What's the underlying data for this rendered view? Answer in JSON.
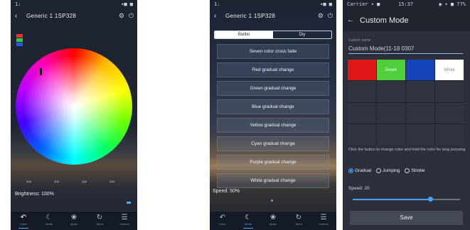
{
  "colors": {
    "accent": "#5aa7e8",
    "cell_red": "#e01818",
    "cell_green": "#4fcf3a",
    "cell_blue": "#1545b8",
    "cell_white": "#ffffff",
    "swatch_red": "#ff2b2b",
    "swatch_green": "#2bd13a",
    "swatch_blue": "#2b56ff"
  },
  "phone1": {
    "status_left": "1:",
    "status_right": "▾■ ■",
    "back_icon": "‹",
    "title": "Generic 1 1SP328",
    "header_icon1": "⚙",
    "header_icon2": "⏻",
    "presets": [
      ">>",
      ">>",
      ">>",
      ">>"
    ],
    "brightness_label": "Brightness: 100%",
    "tabs": [
      {
        "icon": "↶",
        "label": "Color"
      },
      {
        "icon": "☾",
        "label": "Mode"
      },
      {
        "icon": "❀",
        "label": "Music"
      },
      {
        "icon": "↻",
        "label": "Timer"
      },
      {
        "icon": "☰",
        "label": "Custom"
      }
    ]
  },
  "phone2": {
    "status_left": "1:",
    "status_right": "▾■ ■",
    "back_icon": "‹",
    "title": "Generic 1 1SP328",
    "header_icon1": "⚙",
    "header_icon2": "⏻",
    "segments": [
      "Builtin",
      "Diy"
    ],
    "modes": [
      "Seven color cross fade",
      "Red gradual change",
      "Green gradual change",
      "Blue gradual change",
      "Yellow gradual change",
      "Cyan gradual change",
      "Purple gradual change",
      "White gradual change"
    ],
    "speed_label": "Speed: 50%",
    "tabs": [
      {
        "icon": "↶",
        "label": "Color"
      },
      {
        "icon": "☾",
        "label": "Mode"
      },
      {
        "icon": "❀",
        "label": "Music"
      },
      {
        "icon": "↻",
        "label": "Timer"
      },
      {
        "icon": "☰",
        "label": "Custom"
      }
    ]
  },
  "phone3": {
    "status_left": "Carrier ▾ ■",
    "status_center": "15:37",
    "status_right": "◉ ▾ ■ 77%",
    "back_icon": "←",
    "title": "Custom Mode",
    "field_label": "Custom name",
    "field_value": "Custom Mode(11-18 0307",
    "cells": [
      "",
      "Green",
      "",
      "White",
      "",
      "",
      "",
      "",
      "",
      "",
      "",
      "",
      "",
      "",
      "",
      ""
    ],
    "hint": "Click the button to change color and hold the color for long pressing",
    "radios": [
      "Gradual",
      "Jumping",
      "Strobe"
    ],
    "speed_label": "Speed: 20",
    "speed_value": 0.72,
    "save_label": "Save"
  }
}
